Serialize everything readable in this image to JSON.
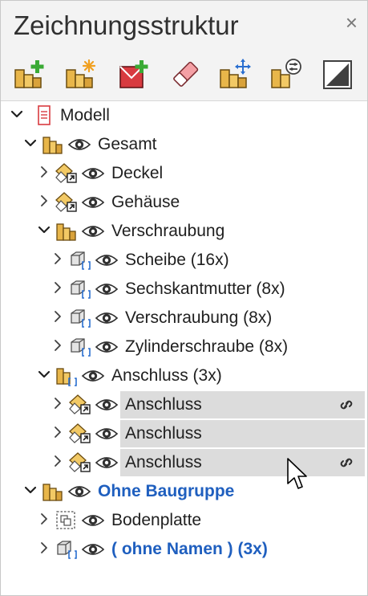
{
  "panel": {
    "title": "Zeichnungsstruktur",
    "close_glyph": "×"
  },
  "toolbar": {
    "buttons": [
      {
        "name": "add-assembly-icon"
      },
      {
        "name": "new-assembly-icon"
      },
      {
        "name": "add-sheet-icon"
      },
      {
        "name": "eraser-icon"
      },
      {
        "name": "move-assembly-icon"
      },
      {
        "name": "assembly-settings-icon"
      },
      {
        "name": "view-toggle-icon"
      }
    ]
  },
  "tree": {
    "items": [
      {
        "label": "Modell",
        "level": 0,
        "expanded": true,
        "icon": "document-icon"
      },
      {
        "label": "Gesamt",
        "level": 1,
        "expanded": true,
        "icon": "assembly-icon"
      },
      {
        "label": "Deckel",
        "level": 2,
        "expanded": false,
        "icon": "reference-part-icon"
      },
      {
        "label": "Gehäuse",
        "level": 2,
        "expanded": false,
        "icon": "reference-part-icon"
      },
      {
        "label": "Verschraubung",
        "level": 2,
        "expanded": true,
        "icon": "assembly-icon"
      },
      {
        "label": "Scheibe (16x)",
        "level": 3,
        "expanded": false,
        "icon": "part-instance-icon"
      },
      {
        "label": "Sechskantmutter (8x)",
        "level": 3,
        "expanded": false,
        "icon": "part-instance-icon"
      },
      {
        "label": "Verschraubung (8x)",
        "level": 3,
        "expanded": false,
        "icon": "part-instance-icon"
      },
      {
        "label": "Zylinderschraube (8x)",
        "level": 3,
        "expanded": false,
        "icon": "part-instance-icon"
      },
      {
        "label": "Anschluss (3x)",
        "level": 2,
        "expanded": true,
        "icon": "assembly-instance-icon"
      },
      {
        "label": "Anschluss",
        "level": 3,
        "expanded": false,
        "icon": "reference-part-icon",
        "selected": true,
        "linked": true
      },
      {
        "label": "Anschluss",
        "level": 3,
        "expanded": false,
        "icon": "reference-part-icon",
        "selected": true,
        "linked": false
      },
      {
        "label": "Anschluss",
        "level": 3,
        "expanded": false,
        "icon": "reference-part-icon",
        "selected": true,
        "linked": true
      },
      {
        "label": "Ohne Baugruppe",
        "level": 1,
        "expanded": true,
        "icon": "assembly-icon",
        "style": "blue"
      },
      {
        "label": "Bodenplatte",
        "level": 2,
        "expanded": false,
        "icon": "dashed-part-icon"
      },
      {
        "label": "( ohne Namen )  (3x)",
        "level": 2,
        "expanded": false,
        "icon": "part-instance-icon",
        "style": "blue"
      }
    ]
  },
  "colors": {
    "accent": "#1f5fbf",
    "selection": "#dcdcdc",
    "add_green": "#3aaa35",
    "orange": "#d79a1e"
  }
}
